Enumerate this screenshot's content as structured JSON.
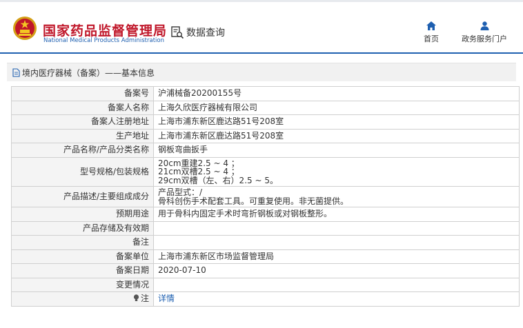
{
  "header": {
    "brand_cn": "国家药品监督管理局",
    "brand_en": "National Medical Products Administration",
    "query_label": "数据查询",
    "nav": [
      {
        "label": "首页",
        "icon": "home-icon"
      },
      {
        "label": "政务服务门户",
        "icon": "user-icon"
      }
    ]
  },
  "breadcrumb": "境内医疗器械（备案）——基本信息",
  "rows": [
    {
      "label": "备案号",
      "value": "沪浦械备20200155号"
    },
    {
      "label": "备案人名称",
      "value": "上海久欣医疗器械有限公司"
    },
    {
      "label": "备案人注册地址",
      "value": "上海市浦东新区鹿达路51号208室"
    },
    {
      "label": "生产地址",
      "value": "上海市浦东新区鹿达路51号208室"
    },
    {
      "label": "产品名称/产品分类名称",
      "value": "钢板弯曲扳手"
    },
    {
      "label": "型号规格/包装规格",
      "value": "20cm重建2.5 ~ 4 ；\n21cm双槽2.5 ~ 4 ；\n29cm双槽（左、右）2.5 ~ 5。"
    },
    {
      "label": "产品描述/主要组成成分",
      "value": "产品型式：/\n骨科创伤手术配套工具。可重复使用。非无菌提供。"
    },
    {
      "label": "预期用途",
      "value": "用于骨科内固定手术时弯折钢板或对钢板整形。"
    },
    {
      "label": "产品存储及有效期",
      "value": ""
    },
    {
      "label": "备注",
      "value": ""
    },
    {
      "label": "备案单位",
      "value": "上海市浦东新区市场监督管理局"
    },
    {
      "label": "备案日期",
      "value": "2020-07-10"
    },
    {
      "label": "变更情况",
      "value": ""
    },
    {
      "label": "注",
      "value": "详情"
    }
  ],
  "colors": {
    "brand_red": "#c0172a",
    "brand_blue": "#1e5fb0",
    "label_bg": "#f4f4f4"
  }
}
